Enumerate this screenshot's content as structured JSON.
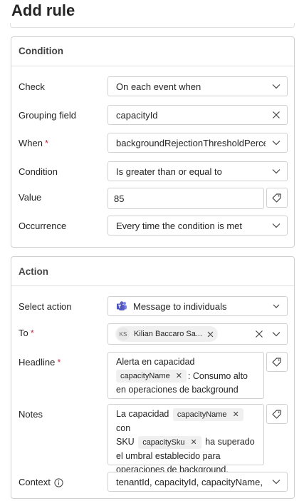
{
  "header": {
    "title": "Add rule"
  },
  "condition": {
    "section_title": "Condition",
    "check": {
      "label": "Check",
      "value": "On each event when"
    },
    "grouping": {
      "label": "Grouping field",
      "value": "capacityId"
    },
    "when": {
      "label": "When",
      "value": "backgroundRejectionThresholdPercen"
    },
    "condition": {
      "label": "Condition",
      "value": "Is greater than or equal to"
    },
    "value": {
      "label": "Value",
      "value": "85"
    },
    "occurrence": {
      "label": "Occurrence",
      "value": "Every time the condition is met"
    }
  },
  "action": {
    "section_title": "Action",
    "select_action": {
      "label": "Select action",
      "value": "Message to individuals"
    },
    "to": {
      "label": "To",
      "recipient_initials": "KS",
      "recipient_name": "Kilian Baccaro Sa..."
    },
    "headline": {
      "label": "Headline",
      "text1": "Alerta en capacidad",
      "chip1": "capacityName",
      "text2": ": Consumo alto",
      "text3": "en operaciones de background"
    },
    "notes": {
      "label": "Notes",
      "text1": "La capacidad",
      "chip1": "capacityName",
      "text2": "con",
      "text3": "SKU",
      "chip2": "capacitySku",
      "text4": "ha superado",
      "text5": "el umbral establecido para",
      "text6": "operaciones de background."
    },
    "context": {
      "label": "Context",
      "value": "tenantId, capacityId, capacityName, ca"
    }
  },
  "icons": {
    "chevron": "chevron-down-icon",
    "clear": "dismiss-icon",
    "tag": "tag-icon",
    "info": "info-icon",
    "teams": "teams-icon"
  },
  "colors": {
    "required": "#c4314b",
    "teams": "#5b5fc7",
    "border": "#d1d1d1"
  }
}
